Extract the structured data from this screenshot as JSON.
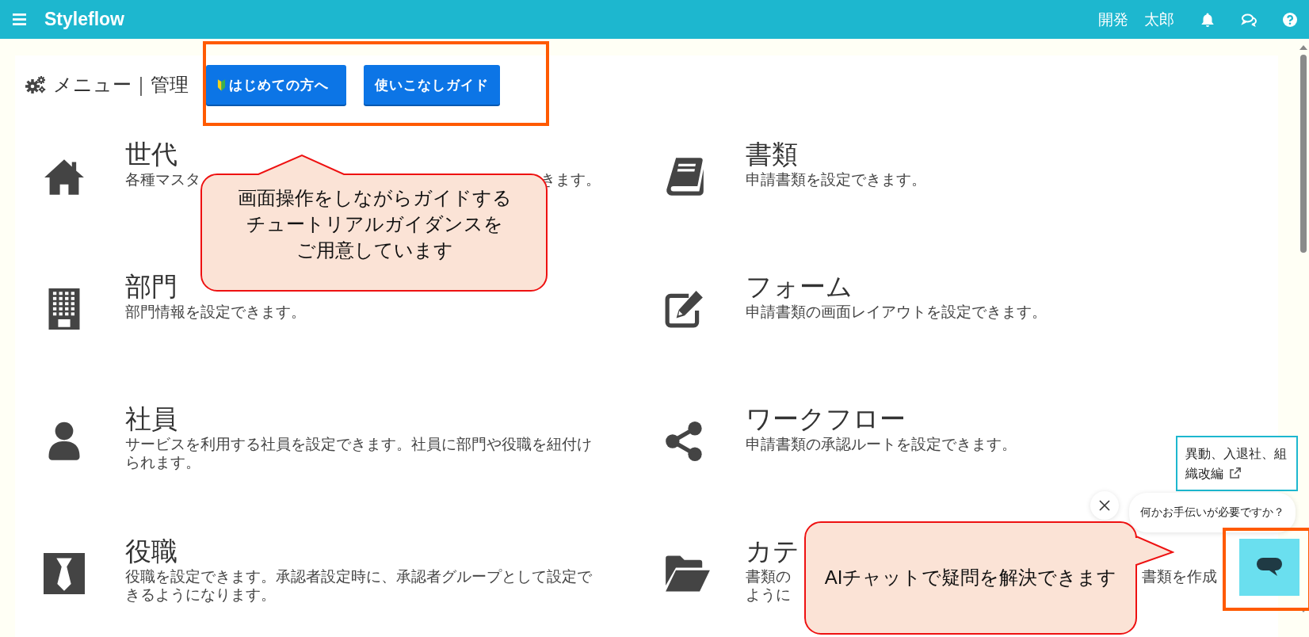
{
  "topbar": {
    "logo": "Styleflow",
    "org": "開発",
    "user": "太郎"
  },
  "heading": "メニュー｜管理",
  "guide_buttons": [
    {
      "kind": "beginner",
      "label": "はじめての方へ"
    },
    {
      "kind": "plain",
      "label": "使いこなしガイド"
    }
  ],
  "menu_items": [
    {
      "title": "世代",
      "description": [
        [
          "各種マスタ",
          "きます。"
        ]
      ]
    },
    {
      "title": "書類",
      "description": [
        [
          "申請書類を設定できます。"
        ]
      ]
    },
    {
      "title": "部門",
      "description": [
        [
          "部門情報を設定できます。"
        ]
      ]
    },
    {
      "title": "フォーム",
      "description": [
        [
          "申請書類の画面レイアウトを設定できます。"
        ]
      ]
    },
    {
      "title": "社員",
      "description": [
        [
          "サービスを利用する社員を設定できます。社員に部門や役職を紐付けられます。"
        ]
      ]
    },
    {
      "title": "ワークフロー",
      "description": [
        [
          "申請書類の承認ルートを設定できます。"
        ]
      ]
    },
    {
      "title": "役職",
      "description": [
        [
          "役職を設定できます。承認者設定時に、承認者グループとして設定できるようになります。"
        ]
      ]
    },
    {
      "title": "カテ",
      "description": [
        [
          "書類の",
          "書類を作成"
        ],
        [
          "ように"
        ]
      ]
    }
  ],
  "chat_widget": {
    "link": "異動、入退社、組織改編",
    "prompt": "何かお手伝いが必要ですか？"
  },
  "callouts": [
    {
      "lines": [
        "画面操作をしながらガイドする",
        "チュートリアルガイダンスを",
        "ご用意しています"
      ]
    },
    {
      "lines": [
        "AIチャットで疑問を解決できます"
      ]
    }
  ]
}
